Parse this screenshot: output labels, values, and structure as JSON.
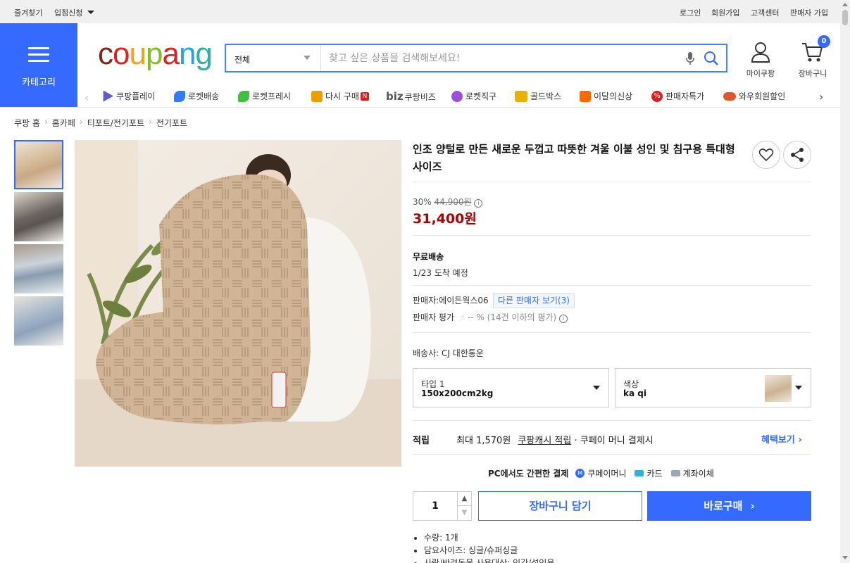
{
  "topbar": {
    "favorites": "즐겨찾기",
    "vendor_apply": "입점신청",
    "login": "로그인",
    "signup": "회원가입",
    "support": "고객센터",
    "seller_signup": "판매자 가입"
  },
  "category": {
    "label": "카테고리"
  },
  "logo": {
    "text": "coupang"
  },
  "search": {
    "scope": "전체",
    "placeholder": "찾고 싶은 상품을 검색해보세요!"
  },
  "mycoupang": {
    "label": "마이쿠팡"
  },
  "cart": {
    "label": "장바구니",
    "count": "0"
  },
  "nav": [
    {
      "label": "쿠팡플레이",
      "icon": "play-icon",
      "color": "#5b5bd6"
    },
    {
      "label": "로켓배송",
      "icon": "rocket-icon",
      "color": "#2f7cf6"
    },
    {
      "label": "로켓프레시",
      "icon": "rocket-fresh-icon",
      "color": "#3fbf3f"
    },
    {
      "label": "다시 구매",
      "icon": "basket-icon",
      "color": "#e8a100"
    },
    {
      "label": "쿠팡비즈",
      "icon": "biz-icon",
      "color": "#555555"
    },
    {
      "label": "로켓직구",
      "icon": "rocket-global-icon",
      "color": "#9a4fe0"
    },
    {
      "label": "골드박스",
      "icon": "goldbox-icon",
      "color": "#e9b100"
    },
    {
      "label": "이달의신상",
      "icon": "new-bag-icon",
      "color": "#ff6a00"
    },
    {
      "label": "판매자특가",
      "icon": "percent-icon",
      "color": "#e01b1b"
    },
    {
      "label": "와우회원할인",
      "icon": "wow-icon",
      "color": "#e0582a"
    }
  ],
  "nav_extra": {
    "biz_prefix": "biz",
    "new_badge": "N"
  },
  "breadcrumb": [
    "쿠팡 홈",
    "홈카페",
    "티포트/전기포트",
    "전기포트"
  ],
  "product": {
    "title": "인조 양털로 만든 새로운 두껍고 따뜻한 겨울 이불 성인 및 침구용 특대형 사이즈",
    "discount": "30%",
    "original_price": "44,900원",
    "price": "31,400원",
    "shipping_title": "무료배송",
    "arrival": "1/23 도착 예정",
    "seller_label": "판매자:",
    "seller_name": "에이든웍스06",
    "other_sellers": "다른 판매자 보기(3)",
    "seller_rating_label": "판매자 평가",
    "seller_rating_value": "-- % (14건 이하의 평가)",
    "carrier": "배송사:  CJ 대한통운",
    "option1": {
      "key": "타입 1",
      "value": "150x200cm2kg"
    },
    "option2": {
      "key": "색상",
      "value": "ka qi"
    },
    "points_label": "적립",
    "points_text": "최대 1,570원",
    "points_link": "쿠팡캐시 적립",
    "points_suffix": "· 쿠페이 머니 결제시",
    "benefit_link": "혜택보기",
    "pay_title": "PC에서도 간편한 결제",
    "pay_methods": [
      "쿠페이머니",
      "카드",
      "계좌이체"
    ],
    "quantity": "1",
    "add_to_cart": "장바구니 담기",
    "buy_now": "바로구매",
    "bullets": [
      "수량: 1개",
      "담요사이즈: 싱글/슈퍼싱글",
      "사람/반려동물 사용대상: 인간/성인용"
    ]
  }
}
